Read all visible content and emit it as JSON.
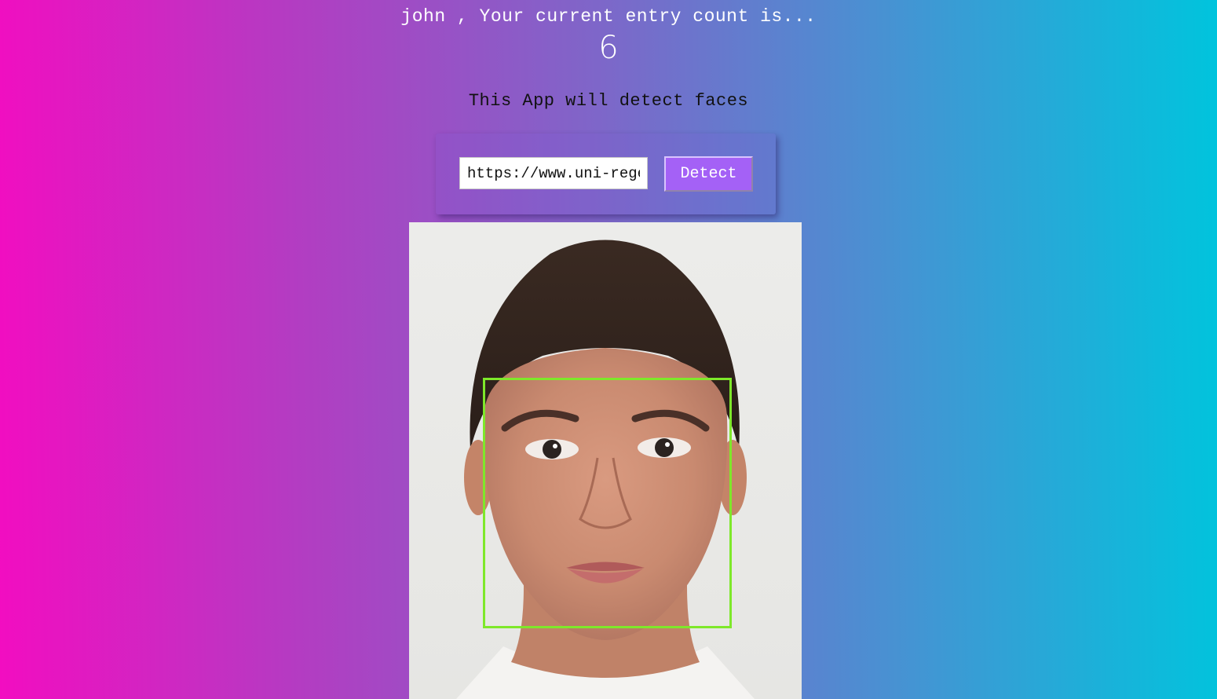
{
  "rank": {
    "greeting": "john , Your current entry count is...",
    "count": "6"
  },
  "intro": {
    "text": "This App will detect faces"
  },
  "form": {
    "url_value": "https://www.uni-regensburg.de/Fakultaeten/phil_Fak_II/Psychologie/Psy_II/beautycheck/english/durchschnittsgesichter/w(01-64)_gr.jpg",
    "button_label": "Detect"
  },
  "image": {
    "alt": "face"
  },
  "colors": {
    "gradient_start": "#f20dc1",
    "gradient_end": "#00c4dd",
    "button": "#a461f6",
    "bounding_box": "#7ee82a"
  }
}
